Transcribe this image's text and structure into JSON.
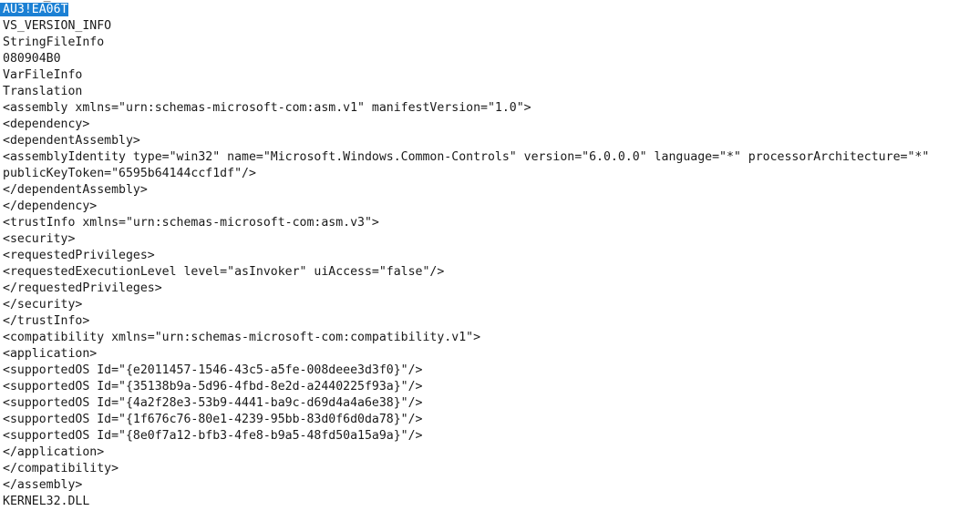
{
  "document": {
    "kind": "strings-dump",
    "background_color": "#ffffff",
    "text_color": "#1a1a1a",
    "selection_background_color": "#1b80d4",
    "selection_text_color": "#ffffff",
    "selected_line_index": 0,
    "clipped_top_fragment": "      _",
    "lines": [
      "AU3!EA06T",
      "VS_VERSION_INFO",
      "StringFileInfo",
      "080904B0",
      "VarFileInfo",
      "Translation",
      "<assembly xmlns=\"urn:schemas-microsoft-com:asm.v1\" manifestVersion=\"1.0\">",
      "<dependency>",
      "<dependentAssembly>",
      "<assemblyIdentity type=\"win32\" name=\"Microsoft.Windows.Common-Controls\" version=\"6.0.0.0\" language=\"*\" processorArchitecture=\"*\"",
      "publicKeyToken=\"6595b64144ccf1df\"/>",
      "</dependentAssembly>",
      "</dependency>",
      "<trustInfo xmlns=\"urn:schemas-microsoft-com:asm.v3\">",
      "<security>",
      "<requestedPrivileges>",
      "<requestedExecutionLevel level=\"asInvoker\" uiAccess=\"false\"/>",
      "</requestedPrivileges>",
      "</security>",
      "</trustInfo>",
      "<compatibility xmlns=\"urn:schemas-microsoft-com:compatibility.v1\">",
      "<application>",
      "<supportedOS Id=\"{e2011457-1546-43c5-a5fe-008deee3d3f0}\"/>",
      "<supportedOS Id=\"{35138b9a-5d96-4fbd-8e2d-a2440225f93a}\"/>",
      "<supportedOS Id=\"{4a2f28e3-53b9-4441-ba9c-d69d4a4a6e38}\"/>",
      "<supportedOS Id=\"{1f676c76-80e1-4239-95bb-83d0f6d0da78}\"/>",
      "<supportedOS Id=\"{8e0f7a12-bfb3-4fe8-b9a5-48fd50a15a9a}\"/>",
      "</application>",
      "</compatibility>",
      "</assembly>",
      "KERNEL32.DLL"
    ]
  }
}
